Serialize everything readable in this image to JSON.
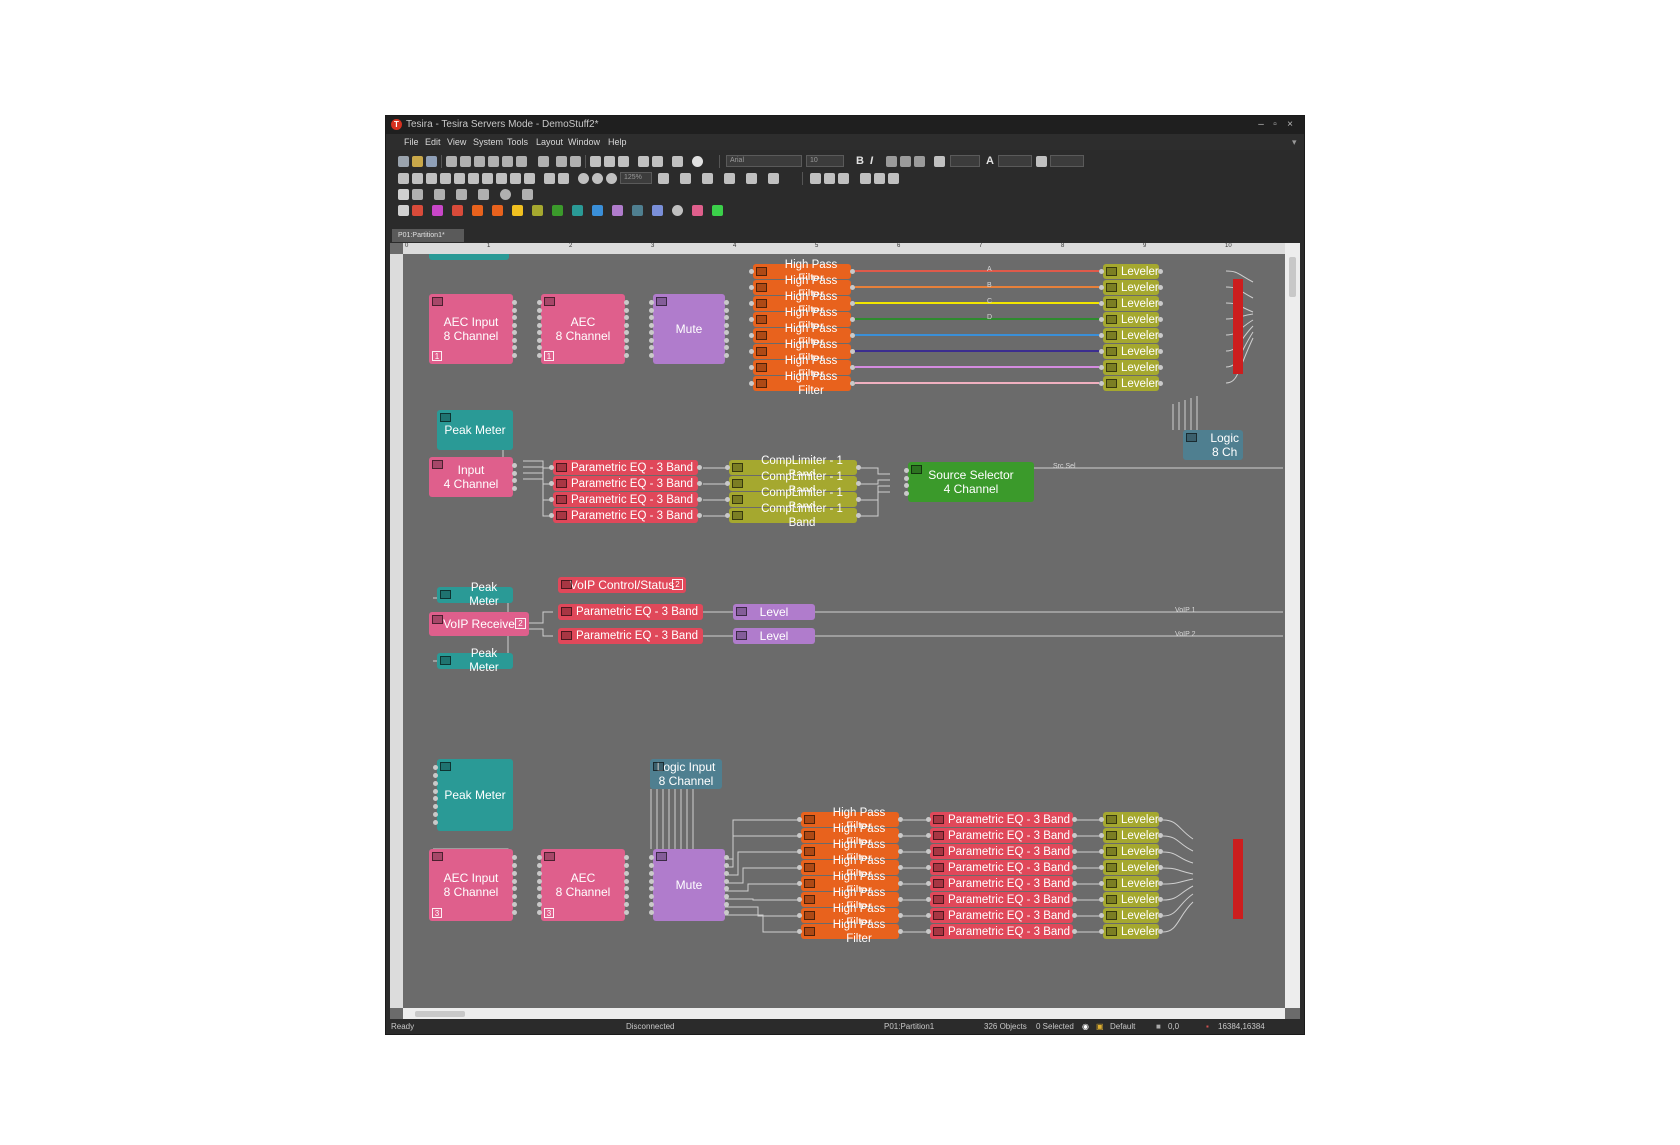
{
  "window": {
    "title": "Tesira - Tesira Servers Mode - DemoStuff2*",
    "app_icon_letter": "T",
    "controls": [
      "–",
      "▫",
      "×"
    ]
  },
  "menu": [
    "File",
    "Edit",
    "View",
    "System",
    "Tools",
    "Layout",
    "Window",
    "Help"
  ],
  "toolbar": {
    "font_name": "Arial",
    "font_size": "10",
    "bold": "B",
    "italic": "I",
    "text_tool": "A",
    "zoom": "125%"
  },
  "tab": {
    "label": "P01:Partition1*"
  },
  "ruler": {
    "marks": [
      "0",
      "1",
      "2",
      "3",
      "4",
      "5",
      "6",
      "7",
      "8",
      "9",
      "10"
    ]
  },
  "blocks": {
    "aec_input_1": {
      "label": "AEC Input\n8 Channel",
      "num": "1"
    },
    "aec_1": {
      "label": "AEC\n8 Channel",
      "num": "1"
    },
    "mute_1": {
      "label": "Mute"
    },
    "hpf_label": "High Pass Filter",
    "leveler_label": "Leveler",
    "wire_letters": [
      "A",
      "B",
      "C",
      "D"
    ],
    "peak_meter": "Peak Meter",
    "input_4ch": {
      "label": "Input\n4 Channel"
    },
    "peq_label": "Parametric EQ - 3 Band",
    "complimiter_label": "CompLimiter - 1 Band",
    "source_selector": {
      "label": "Source Selector\n4 Channel"
    },
    "src_sel_label": "Src Sel",
    "logic_partial": {
      "label": "Logic\n8 Ch"
    },
    "voip_control": {
      "label": "VoIP Control/Status",
      "num": "2"
    },
    "voip_receive": {
      "label": "VoIP Receive",
      "num": "2"
    },
    "level_label": "Level",
    "voip_wires": [
      "VoIP 1",
      "VoIP 2"
    ],
    "logic_input": {
      "label": "Logic Input\n8 Channel"
    },
    "aec_input_3": {
      "label": "AEC Input\n8 Channel",
      "num": "3"
    },
    "aec_3": {
      "label": "AEC\n8 Channel",
      "num": "3"
    },
    "mute_3": {
      "label": "Mute"
    }
  },
  "wire_colors": [
    "#e05a4a",
    "#e8803a",
    "#f2e600",
    "#2e8b2e",
    "#3a8fd8",
    "#3b2d8f",
    "#d48be0",
    "#f0b0c0"
  ],
  "status": {
    "ready": "Ready",
    "connection": "Disconnected",
    "partition": "P01:Partition1",
    "objects": "326 Objects",
    "selected": "0 Selected",
    "layer": "Default",
    "position": "0,0",
    "size": "16384,16384"
  }
}
